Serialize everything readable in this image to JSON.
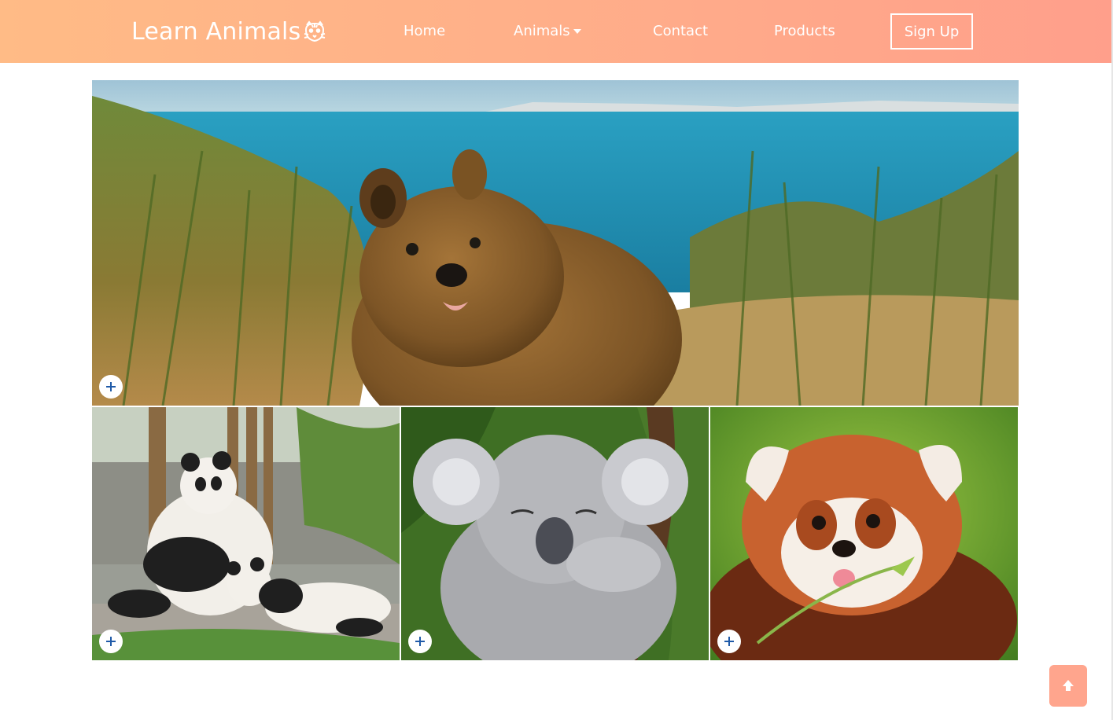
{
  "header": {
    "brand": "Learn Animals",
    "brand_icon": "tiger-icon",
    "nav": [
      {
        "label": "Home"
      },
      {
        "label": "Animals",
        "icon": "caret-down-icon"
      },
      {
        "label": "Contact"
      },
      {
        "label": "Products"
      }
    ],
    "signup_label": "Sign Up",
    "gradient": [
      "#ffbb86",
      "#ff9f8b"
    ]
  },
  "gallery": {
    "photos": [
      {
        "subject": "quokka",
        "action_icon": "plus-icon"
      },
      {
        "subject": "giant pandas",
        "action_icon": "plus-icon"
      },
      {
        "subject": "koala",
        "action_icon": "plus-icon"
      },
      {
        "subject": "red panda",
        "action_icon": "plus-icon"
      }
    ]
  },
  "colors": {
    "accent": "#ffa58d",
    "plus_icon": "#1f5aa8"
  },
  "back_to_top_icon": "arrow-up-icon"
}
